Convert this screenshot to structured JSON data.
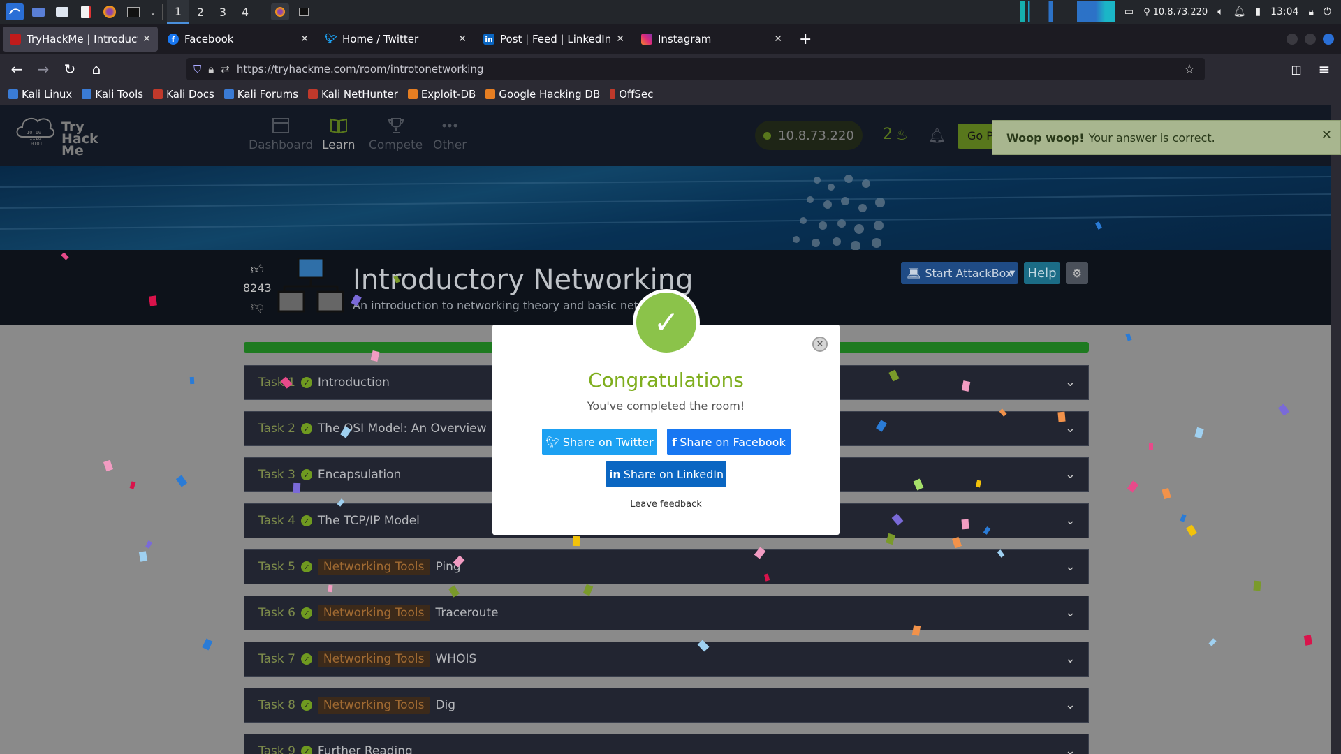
{
  "taskbar": {
    "workspaces": [
      "1",
      "2",
      "3",
      "4"
    ],
    "tray_ip": "10.8.73.220",
    "clock": "13:04"
  },
  "tabs": [
    {
      "label": "TryHackMe | Introductory",
      "color": "#c11b1b"
    },
    {
      "label": "Facebook",
      "color": "#1877f2"
    },
    {
      "label": "Home / Twitter",
      "color": "#1da1f2"
    },
    {
      "label": "Post | Feed | LinkedIn",
      "color": "#0a66c2"
    },
    {
      "label": "Instagram",
      "color": "#d62976"
    }
  ],
  "url": "https://tryhackme.com/room/introtonetworking",
  "bookmarks": [
    {
      "label": "Kali Linux",
      "color": "#3a7bd5"
    },
    {
      "label": "Kali Tools",
      "color": "#3a7bd5"
    },
    {
      "label": "Kali Docs",
      "color": "#c0392b"
    },
    {
      "label": "Kali Forums",
      "color": "#3a7bd5"
    },
    {
      "label": "Kali NetHunter",
      "color": "#c0392b"
    },
    {
      "label": "Exploit-DB",
      "color": "#e67e22"
    },
    {
      "label": "Google Hacking DB",
      "color": "#e67e22"
    },
    {
      "label": "OffSec",
      "color": "#c0392b"
    }
  ],
  "thm": {
    "logo_text": [
      "Try",
      "Hack",
      "Me"
    ],
    "nav": [
      "Dashboard",
      "Learn",
      "Compete",
      "Other"
    ],
    "ip": "10.8.73.220",
    "streak": "2",
    "go_label": "Go P"
  },
  "room": {
    "title": "Introductory Networking",
    "subtitle": "An introduction to networking theory and basic network",
    "votes": "8243",
    "attackbox_label": "Start AttackBox",
    "help_label": "Help"
  },
  "tasks": [
    {
      "num": "Task 1",
      "tag": "",
      "name": "Introduction"
    },
    {
      "num": "Task 2",
      "tag": "",
      "name": "The OSI Model: An Overview"
    },
    {
      "num": "Task 3",
      "tag": "",
      "name": "Encapsulation"
    },
    {
      "num": "Task 4",
      "tag": "",
      "name": "The TCP/IP Model"
    },
    {
      "num": "Task 5",
      "tag": "Networking Tools",
      "name": "Ping"
    },
    {
      "num": "Task 6",
      "tag": "Networking Tools",
      "name": "Traceroute"
    },
    {
      "num": "Task 7",
      "tag": "Networking Tools",
      "name": "WHOIS"
    },
    {
      "num": "Task 8",
      "tag": "Networking Tools",
      "name": "Dig"
    },
    {
      "num": "Task 9",
      "tag": "",
      "name": "Further Reading"
    }
  ],
  "toast": {
    "bold": "Woop woop!",
    "text": "Your answer is correct."
  },
  "modal": {
    "title": "Congratulations",
    "subtitle": "You've completed the room!",
    "twitter": "Share on Twitter",
    "facebook": "Share on Facebook",
    "linkedin": "Share on LinkedIn",
    "feedback": "Leave feedback"
  }
}
